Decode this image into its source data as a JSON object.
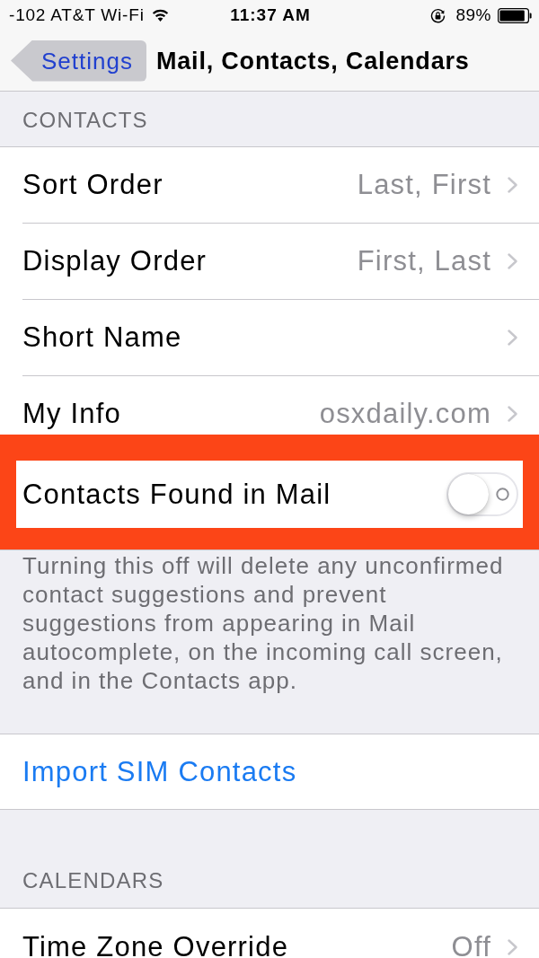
{
  "status_bar": {
    "carrier": "-102 AT&T Wi-Fi",
    "time": "11:37 AM",
    "battery": "89%"
  },
  "nav_bar": {
    "back": "Settings",
    "title": "Mail, Contacts, Calendars"
  },
  "sections": [
    {
      "header": "CONTACTS",
      "rows": [
        {
          "kind": "disclosure",
          "label": "Sort Order",
          "value": "Last, First",
          "highlighted": false
        },
        {
          "kind": "disclosure",
          "label": "Display Order",
          "value": "First, Last",
          "highlighted": false
        },
        {
          "kind": "disclosure",
          "label": "Short Name",
          "highlighted": false
        },
        {
          "kind": "disclosure",
          "label": "My Info",
          "value": "osxdaily.com",
          "highlighted": false
        },
        {
          "kind": "toggle",
          "label": "Contacts Found in Mail",
          "on": false,
          "highlighted": true
        }
      ],
      "footer": "Turning this off will delete any unconfirmed contact suggestions and prevent suggestions from appearing in Mail autocomplete, on the incoming call screen, and in the Contacts app."
    },
    {
      "rows": [
        {
          "kind": "action",
          "label": "Import SIM Contacts",
          "highlighted": false
        }
      ]
    },
    {
      "header": "CALENDARS",
      "rows": [
        {
          "kind": "disclosure",
          "label": "Time Zone Override",
          "value": "Off",
          "highlighted": false
        }
      ]
    }
  ]
}
